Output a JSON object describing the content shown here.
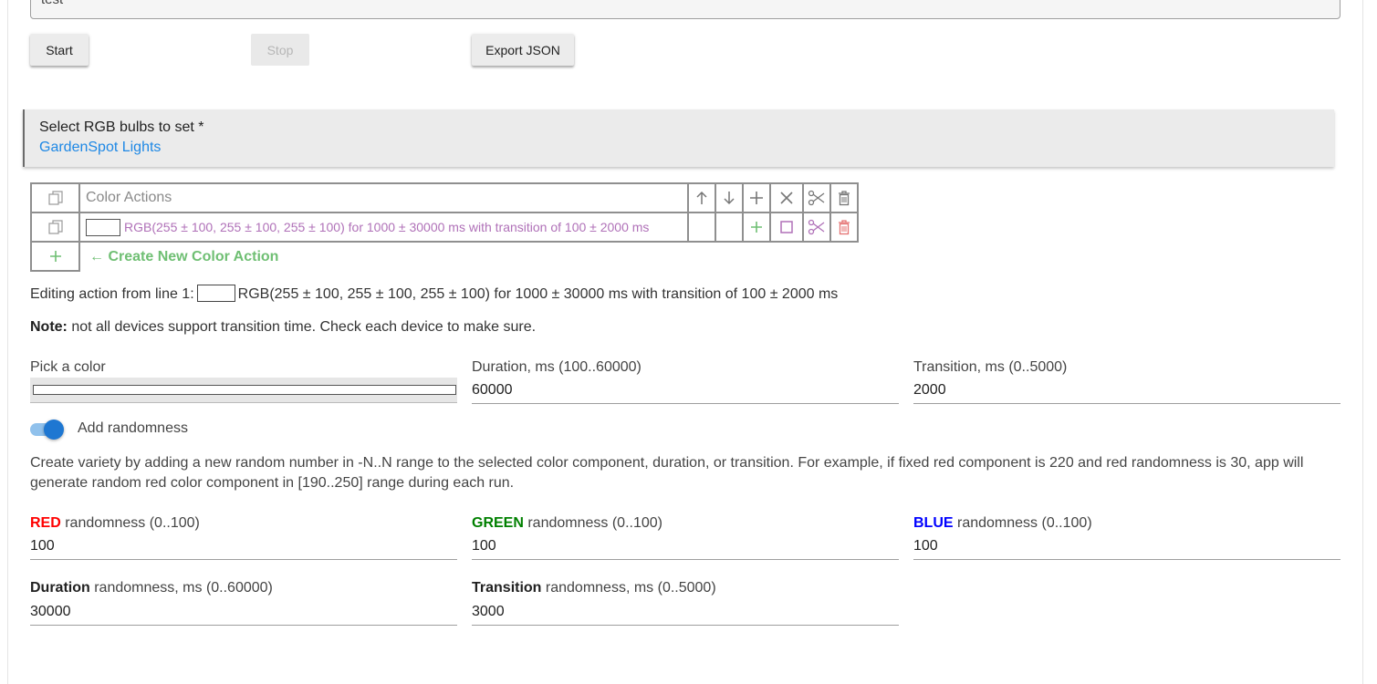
{
  "scene_name": "test",
  "buttons": {
    "start": "Start",
    "stop": "Stop",
    "export": "Export JSON"
  },
  "bulbs": {
    "label": "Select RGB bulbs to set *",
    "value": "GardenSpot Lights"
  },
  "table": {
    "header": "Color Actions",
    "rows": [
      {
        "swatch_color": "#ffffff",
        "text": "RGB(255 ± 100, 255 ± 100, 255 ± 100) for 1000 ± 30000 ms with transition of 100 ± 2000 ms"
      }
    ],
    "create_new": "← Create New Color Action"
  },
  "editing": {
    "prefix": "Editing action from line 1:",
    "text": "RGB(255 ± 100, 255 ± 100, 255 ± 100) for 1000 ± 30000 ms with transition of 100 ± 2000 ms"
  },
  "note": {
    "label": "Note:",
    "text": "not all devices support transition time. Check each device to make sure."
  },
  "fields": {
    "color_label": "Pick a color",
    "color_value": "#ffffff",
    "duration_label": "Duration, ms (100..60000)",
    "duration_value": "60000",
    "transition_label": "Transition, ms (0..5000)",
    "transition_value": "2000"
  },
  "randomness": {
    "toggle_label": "Add randomness",
    "toggle_on": true,
    "description_line1": "Create variety by adding a new random number in -N..N range to the selected color component, duration, or transition. For example, if fixed red component is 220 and red randomness is 30, app will",
    "description_line2": "generate random red color component in [190..250] range during each run.",
    "red_word": "RED",
    "red_rest": " randomness (0..100)",
    "red_value": "100",
    "green_word": "GREEN",
    "green_rest": " randomness (0..100)",
    "green_value": "100",
    "blue_word": "BLUE",
    "blue_rest": " randomness (0..100)",
    "blue_value": "100",
    "duration_word": "Duration",
    "duration_rest": " randomness, ms (0..60000)",
    "duration_value": "30000",
    "transition_word": "Transition",
    "transition_rest": " randomness, ms (0..5000)",
    "transition_value": "3000"
  },
  "colors": {
    "accent_blue": "#1e88e5",
    "action_purple": "#b071b8",
    "create_green": "#6fbf73",
    "delete_red": "#e57373"
  }
}
